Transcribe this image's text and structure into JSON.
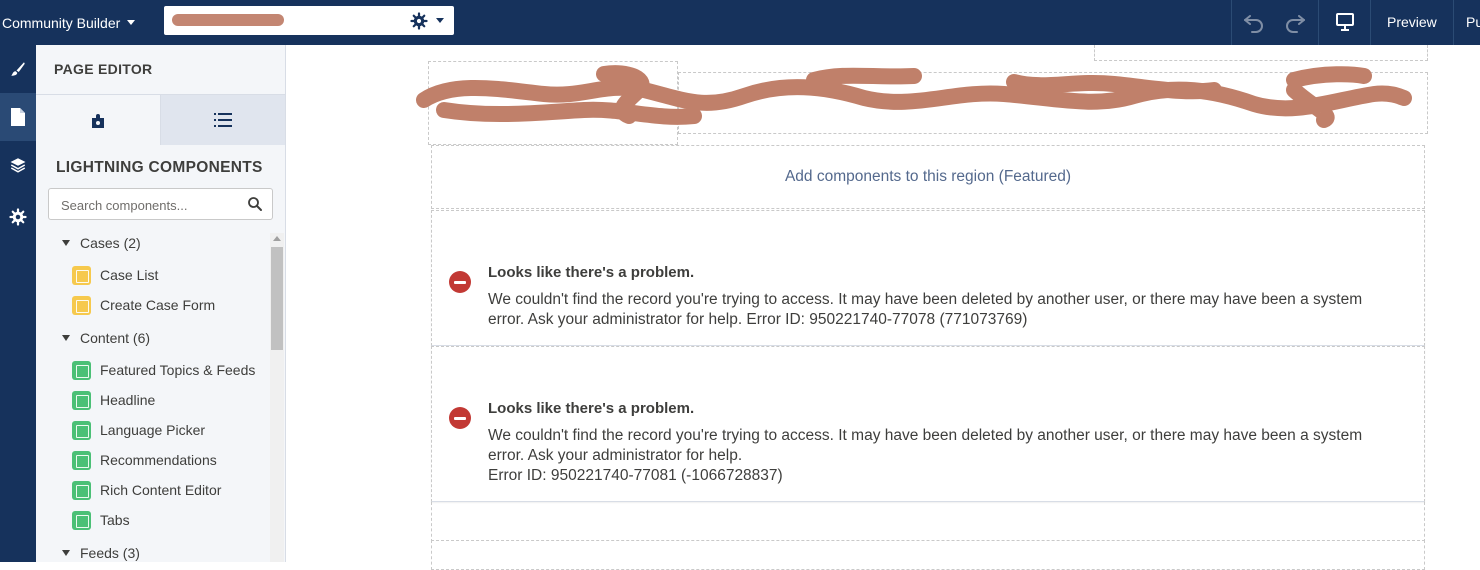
{
  "topbar": {
    "app_name": "Community Builder",
    "preview_label": "Preview",
    "publish_label": "Pu"
  },
  "panel": {
    "title": "PAGE EDITOR",
    "section_title": "LIGHTNING COMPONENTS",
    "search_placeholder": "Search components...",
    "groups": [
      {
        "label": "Cases (2)",
        "items": [
          "Case List",
          "Create Case Form"
        ]
      },
      {
        "label": "Content (6)",
        "items": [
          "Featured Topics & Feeds",
          "Headline",
          "Language Picker",
          "Recommendations",
          "Rich Content Editor",
          "Tabs"
        ]
      },
      {
        "label": "Feeds (3)",
        "items": []
      }
    ]
  },
  "canvas": {
    "featured_placeholder": "Add components to this region (Featured)",
    "errors": [
      {
        "title": "Looks like there's a problem.",
        "line1": "We couldn't find the record you're trying to access. It may have been deleted by another user, or there may have been a system",
        "line2": "error. Ask your administrator for help. Error ID: 950221740-77078 (771073769)",
        "line3": ""
      },
      {
        "title": "Looks like there's a problem.",
        "line1": "We couldn't find the record you're trying to access. It may have been deleted by another user, or there may have been a system",
        "line2": "error. Ask your administrator for help.",
        "line3": "Error ID: 950221740-77081 (-1066728837)"
      }
    ]
  },
  "colors": {
    "header_bg": "#16325c",
    "error_red": "#c23934",
    "redaction": "#c0806a",
    "component_yellow": "#f6c94d",
    "component_green": "#4bc076"
  }
}
